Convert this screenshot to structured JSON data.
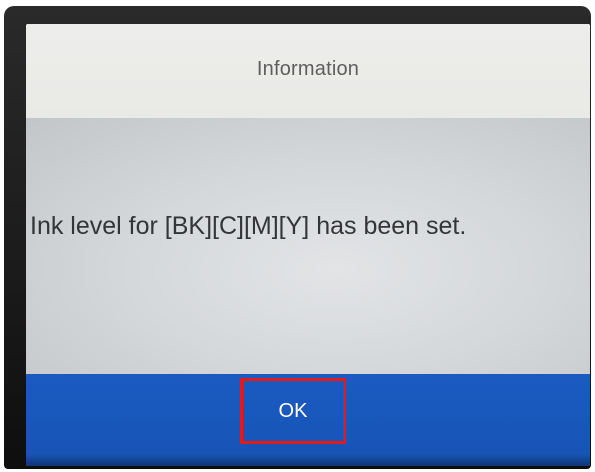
{
  "dialog": {
    "title": "Information",
    "message": "Ink level for [BK][C][M][Y] has been set.",
    "ok_label": "OK"
  },
  "colors": {
    "title_bar": "#ececea",
    "body": "#d4d7da",
    "button_bar": "#1a5bc2",
    "highlight_border": "#e01b1b",
    "bezel": "#1a1a1a"
  }
}
